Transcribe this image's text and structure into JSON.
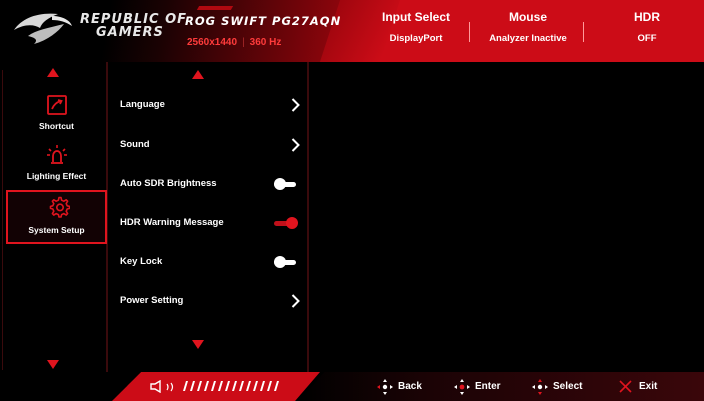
{
  "header": {
    "brand_line1": "REPUBLIC OF",
    "brand_line2": "GAMERS",
    "model": "ROG SWIFT PG27AQN",
    "resolution": "2560x1440",
    "refresh": "360 Hz",
    "status": [
      {
        "key": "Input Select",
        "value": "DisplayPort"
      },
      {
        "key": "Mouse",
        "value": "Analyzer Inactive"
      },
      {
        "key": "HDR",
        "value": "OFF"
      }
    ]
  },
  "sidebar": {
    "items": [
      {
        "label": "Shortcut",
        "icon": "shortcut-icon"
      },
      {
        "label": "Lighting Effect",
        "icon": "lighting-effect-icon"
      },
      {
        "label": "System Setup",
        "icon": "gear-icon",
        "active": true
      }
    ]
  },
  "menu": {
    "items": [
      {
        "label": "Language",
        "control": "chevron"
      },
      {
        "label": "Sound",
        "control": "chevron"
      },
      {
        "label": "Auto SDR Brightness",
        "control": "toggle",
        "state": "off"
      },
      {
        "label": "HDR Warning Message",
        "control": "toggle",
        "state": "on"
      },
      {
        "label": "Key Lock",
        "control": "toggle",
        "state": "off"
      },
      {
        "label": "Power Setting",
        "control": "chevron"
      }
    ]
  },
  "footer": {
    "back": "Back",
    "enter": "Enter",
    "select": "Select",
    "exit": "Exit"
  },
  "colors": {
    "accent": "#e0141e",
    "header_red": "#cc0c17",
    "background": "#000000"
  }
}
